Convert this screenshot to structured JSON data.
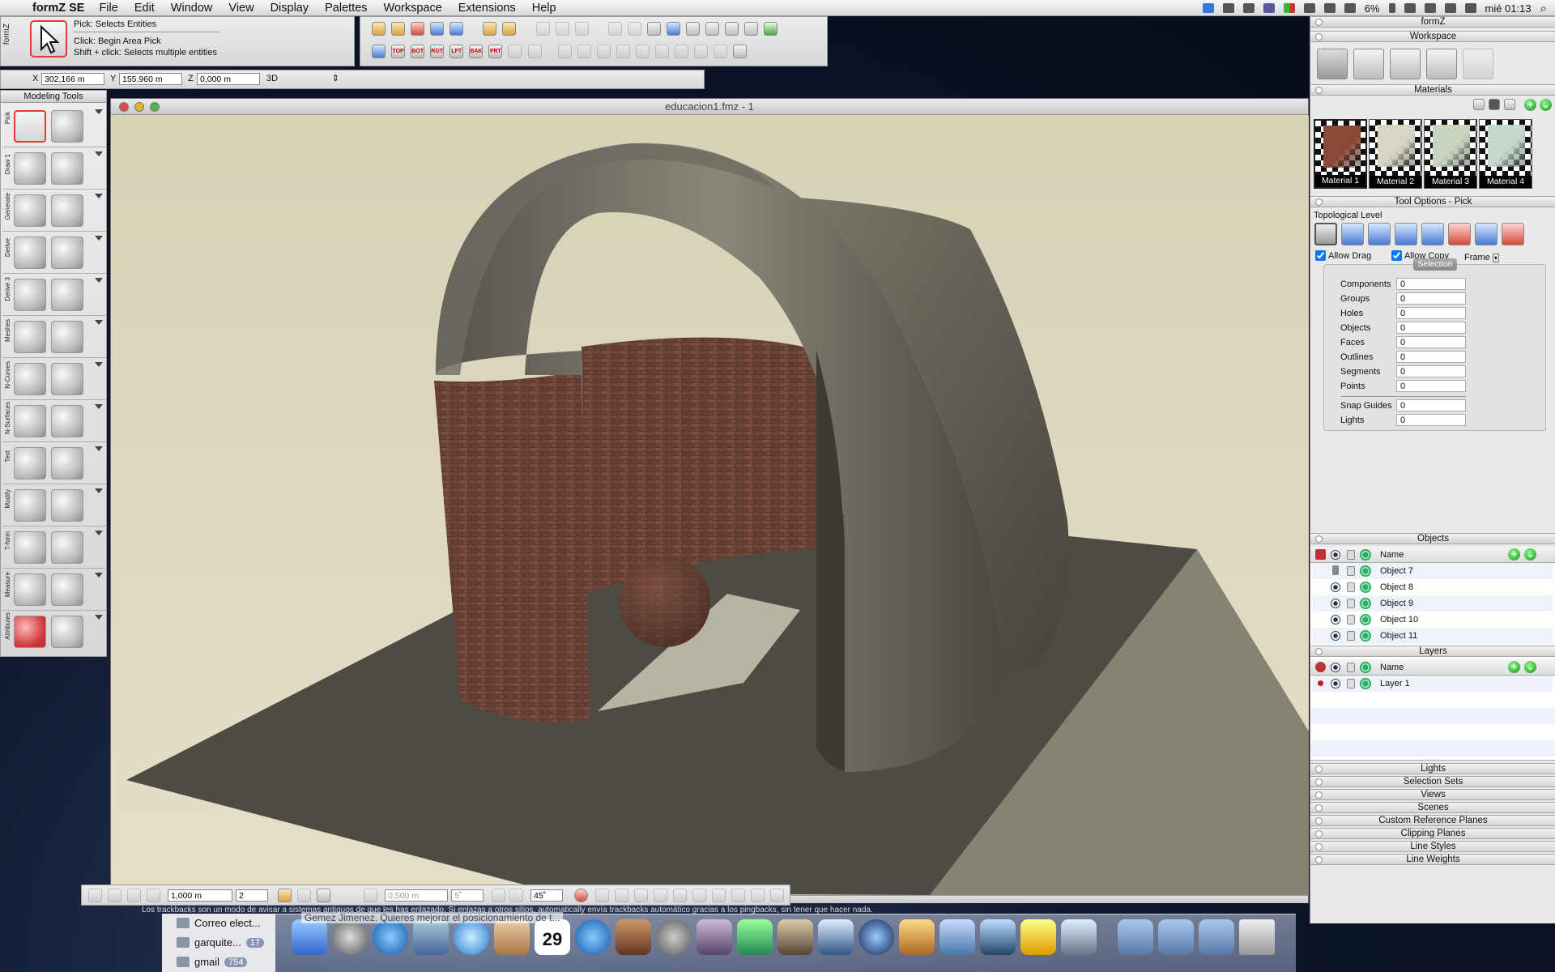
{
  "menubar": {
    "app_name": "formZ SE",
    "items": [
      "File",
      "Edit",
      "Window",
      "View",
      "Display",
      "Palettes",
      "Workspace",
      "Extensions",
      "Help"
    ],
    "battery": "6%",
    "clock": "mié 01:13"
  },
  "pick_panel": {
    "side_label": "formZ",
    "title": "Pick:  Selects Entities",
    "line1": "Click: Begin Area Pick",
    "line2": "Shift + click: Selects multiple entities"
  },
  "coords": {
    "x_label": "X",
    "x_value": "302,166 m",
    "y_label": "Y",
    "y_value": "155,960 m",
    "z_label": "Z",
    "z_value": "0,000 m",
    "mode": "3D"
  },
  "view_buttons": [
    "TOP",
    "BOT",
    "RGT",
    "LFT",
    "BAK",
    "FRT"
  ],
  "modeling_tools": {
    "title": "Modeling Tools",
    "groups": [
      "Pick",
      "Draw 1",
      "Generate",
      "Derive",
      "Derive 3",
      "Meshes",
      "N-Curves",
      "N-Surfaces",
      "Text",
      "Modify",
      "T-form",
      "Measure",
      "Attributes"
    ]
  },
  "document": {
    "title": "educacion1.fmz - 1"
  },
  "bottom_toolbar": {
    "grid": "1,000 m",
    "divisions": "2",
    "snap": "0,500 m",
    "angle_small": "5˚",
    "angle": "45˚"
  },
  "right_panel": {
    "title": "formZ",
    "workspace": "Workspace",
    "materials_title": "Materials",
    "materials": [
      {
        "name": "Material 1",
        "color": "#8a4a38"
      },
      {
        "name": "Material 2",
        "color": "#d8d5c4"
      },
      {
        "name": "Material 3",
        "color": "#c8d4c0"
      },
      {
        "name": "Material 4",
        "color": "#c4d8cc"
      }
    ],
    "tool_options_title": "Tool Options - Pick",
    "topological_level": "Topological Level",
    "allow_drag": "Allow Drag",
    "allow_copy": "Allow Copy",
    "frame": "Frame",
    "selection_button": "Selection",
    "selection_rows": [
      {
        "label": "Components",
        "value": "0"
      },
      {
        "label": "Groups",
        "value": "0"
      },
      {
        "label": "Holes",
        "value": "0"
      },
      {
        "label": "Objects",
        "value": "0"
      },
      {
        "label": "Faces",
        "value": "0"
      },
      {
        "label": "Outlines",
        "value": "0"
      },
      {
        "label": "Segments",
        "value": "0"
      },
      {
        "label": "Points",
        "value": "0"
      }
    ],
    "extra_rows": [
      {
        "label": "Snap Guides",
        "value": "0"
      },
      {
        "label": "Lights",
        "value": "0"
      }
    ],
    "objects_title": "Objects",
    "objects_header": "Name",
    "objects": [
      "Object 7",
      "Object 8",
      "Object 9",
      "Object 10",
      "Object 11"
    ],
    "layers_title": "Layers",
    "layers_header": "Name",
    "layers": [
      "Layer 1"
    ],
    "collapsed_sections": [
      "Lights",
      "Selection Sets",
      "Views",
      "Scenes",
      "Custom Reference Planes",
      "Clipping Planes",
      "Line Styles",
      "Line Weights"
    ]
  },
  "mail": {
    "folders": [
      {
        "name": "Correo elect...",
        "count": ""
      },
      {
        "name": "garquite...",
        "count": "17"
      },
      {
        "name": "gmail",
        "count": "754"
      }
    ],
    "preview_text": "Gemez Jimenez. Quieres mejorar el posicionamiento de t...",
    "status_text": "Los trackbacks son un modo de avisar a sistemas antiguos de que les has enlazado. Si enlazas a otros sitios, automatically envía trackbacks automático gracias a los pingbacks, sin tener que hacer nada."
  },
  "dock": {
    "calendar_day": "29"
  }
}
